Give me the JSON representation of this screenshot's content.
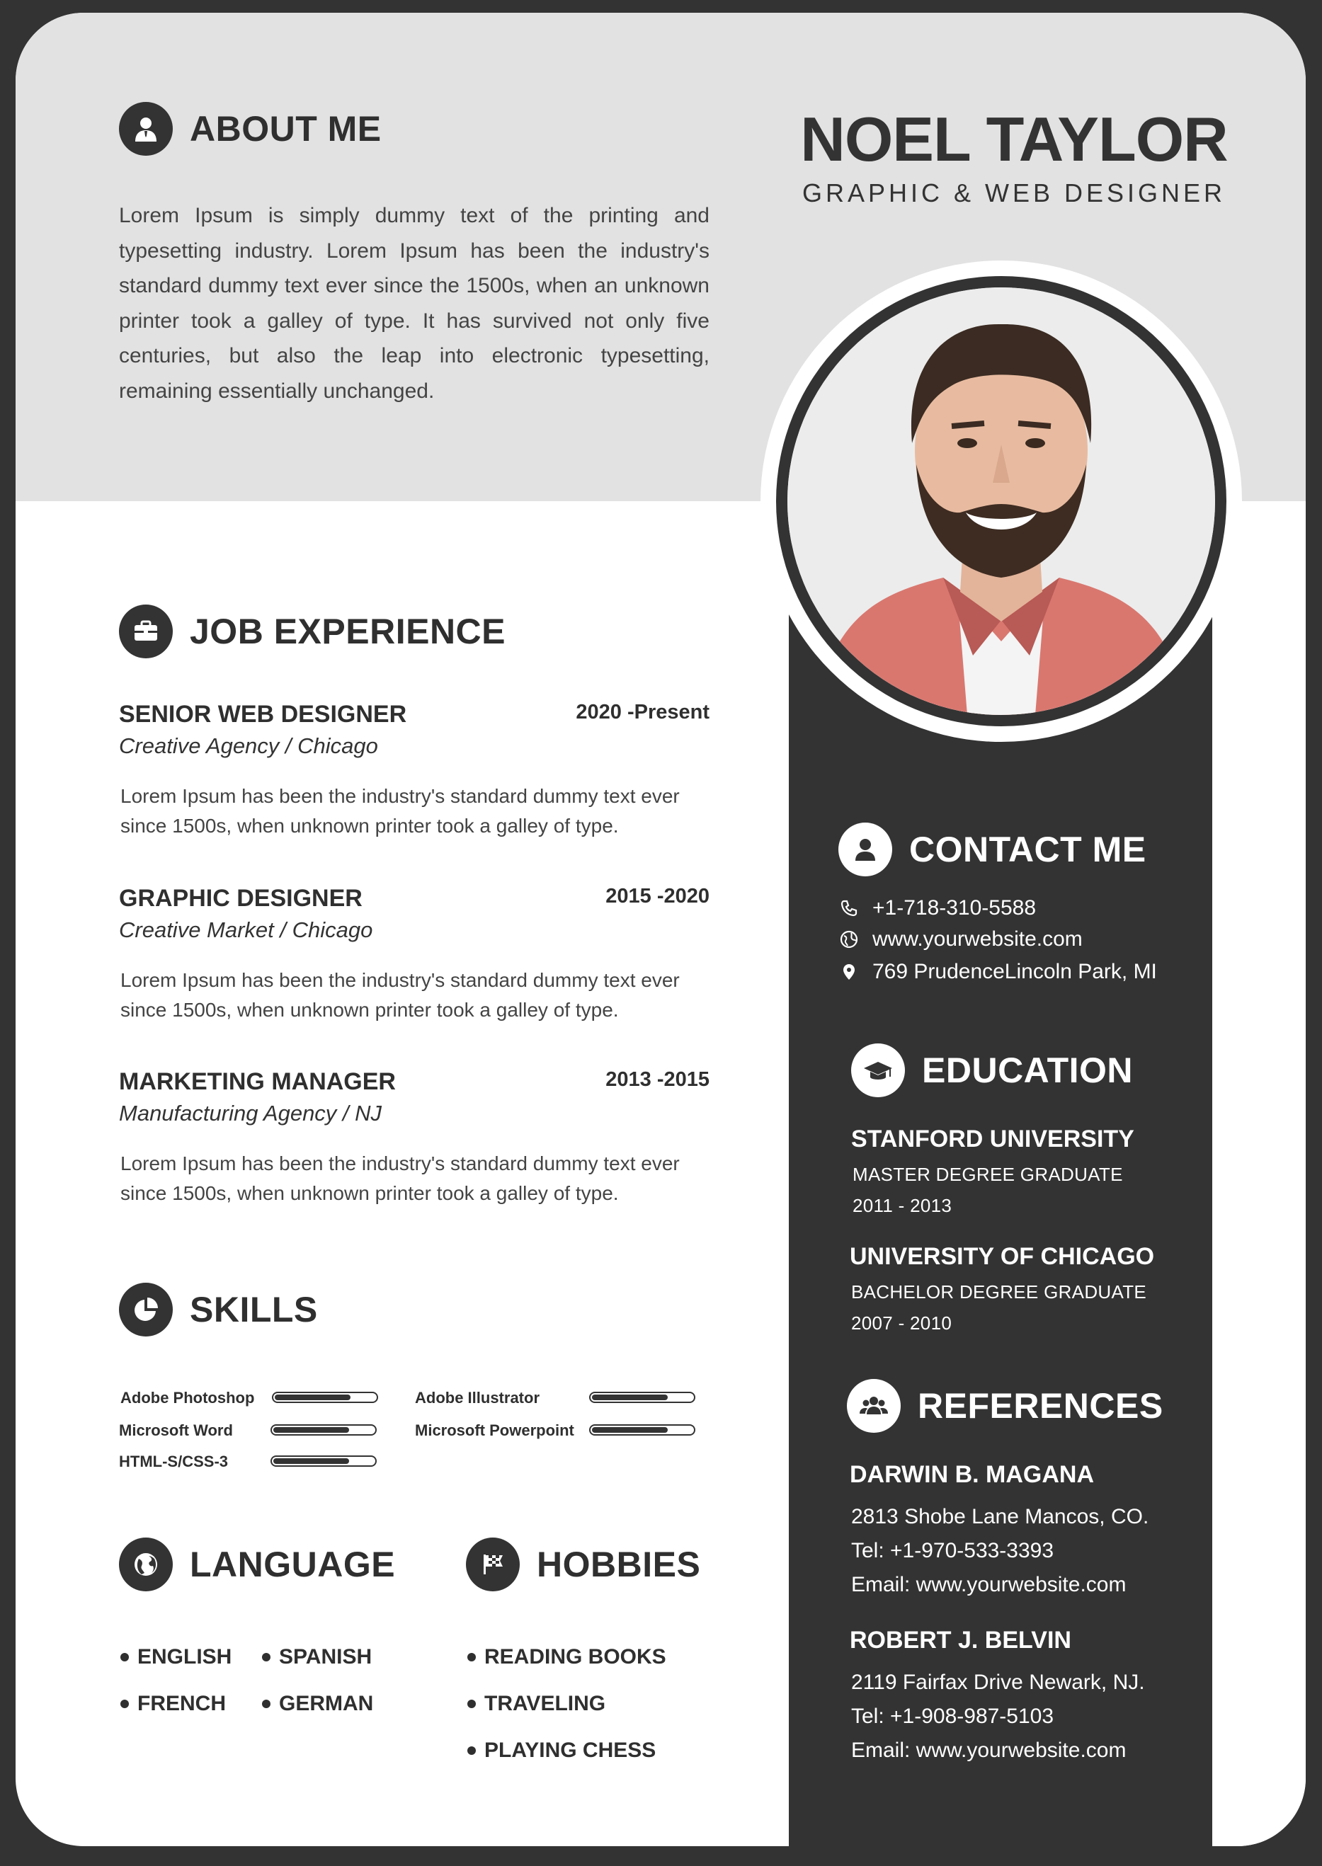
{
  "header": {
    "name": "NOEL TAYLOR",
    "title": "GRAPHIC & WEB DESIGNER"
  },
  "about": {
    "heading": "ABOUT ME",
    "text": "Lorem Ipsum is simply dummy text of the printing and typesetting industry. Lorem Ipsum has been the industry's standard dummy text ever since the 1500s, when an unknown printer took a galley of type. It has survived not only five centuries, but also the leap into electronic typesetting, remaining essentially unchanged."
  },
  "experience": {
    "heading": "JOB EXPERIENCE",
    "jobs": [
      {
        "title": "SENIOR WEB DESIGNER",
        "dates": "2020 -Present",
        "company": "Creative Agency / Chicago",
        "desc1": "Lorem Ipsum has been the industry's standard dummy text ever",
        "desc2": "since 1500s, when unknown printer took a galley of type."
      },
      {
        "title": "GRAPHIC DESIGNER",
        "dates": "2015 -2020",
        "company": "Creative Market / Chicago",
        "desc1": "Lorem Ipsum has been the industry's standard dummy text ever",
        "desc2": "since 1500s, when unknown printer took a galley of type."
      },
      {
        "title": "MARKETING MANAGER",
        "dates": "2013 -2015",
        "company": "Manufacturing Agency / NJ",
        "desc1": "Lorem Ipsum has been the industry's standard dummy text ever",
        "desc2": "since 1500s, when unknown printer took a galley of type."
      }
    ]
  },
  "skills": {
    "heading": "SKILLS",
    "items": [
      {
        "name": "Adobe Photoshop",
        "level": 0.75
      },
      {
        "name": "Adobe Illustrator",
        "level": 0.75
      },
      {
        "name": "Microsoft Word",
        "level": 0.75
      },
      {
        "name": "Microsoft Powerpoint",
        "level": 0.75
      },
      {
        "name": "HTML-S/CSS-3",
        "level": 0.75
      }
    ]
  },
  "language": {
    "heading": "LANGUAGE",
    "items": [
      "ENGLISH",
      "SPANISH",
      "FRENCH",
      "GERMAN"
    ]
  },
  "hobbies": {
    "heading": "HOBBIES",
    "items": [
      "READING BOOKS",
      "TRAVELING",
      "PLAYING CHESS"
    ]
  },
  "contact": {
    "heading": "CONTACT ME",
    "phone": "+1-718-310-5588",
    "website": "www.yourwebsite.com",
    "address": "769 PrudenceLincoln Park, MI",
    "icons": [
      "phone-icon",
      "globe-icon",
      "location-pin-icon"
    ]
  },
  "education": {
    "heading": "EDUCATION",
    "items": [
      {
        "school": "STANFORD UNIVERSITY",
        "degree": "MASTER DEGREE GRADUATE",
        "years": "2011 - 2013"
      },
      {
        "school": "UNIVERSITY OF CHICAGO",
        "degree": "BACHELOR DEGREE GRADUATE",
        "years": "2007 - 2010"
      }
    ]
  },
  "references": {
    "heading": "REFERENCES",
    "items": [
      {
        "name": "DARWIN B. MAGANA",
        "address": "2813 Shobe Lane Mancos, CO.",
        "tel": "Tel: +1-970-533-3393",
        "email": "Email: www.yourwebsite.com"
      },
      {
        "name": "ROBERT J. BELVIN",
        "address": "2119 Fairfax Drive Newark, NJ.",
        "tel": "Tel: +1-908-987-5103",
        "email": "Email: www.yourwebsite.com"
      }
    ]
  },
  "colors": {
    "dark": "#333333",
    "light_band": "#e2e2e2",
    "paper": "#ffffff"
  }
}
